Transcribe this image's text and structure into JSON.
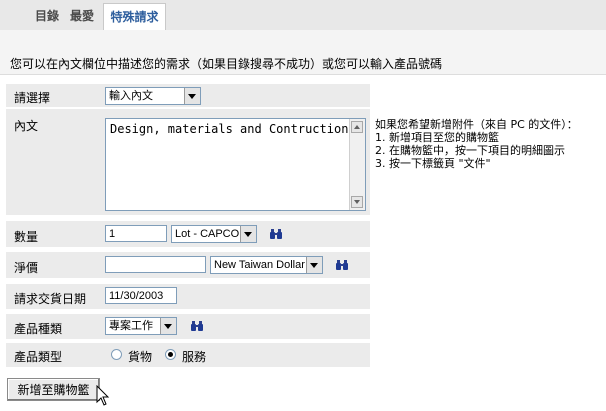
{
  "tabs": [
    {
      "label": "目錄"
    },
    {
      "label": "最愛"
    },
    {
      "label": "特殊請求"
    }
  ],
  "intro": "您可以在內文欄位中描述您的需求（如果目錄搜尋不成功）或您可以輸入產品號碼",
  "form": {
    "select_label": "請選擇",
    "select_value": "輸入內文",
    "content_label": "內文",
    "content_value": "Design, materials and Contruction",
    "quantity_label": "數量",
    "quantity_value": "1",
    "unit_value": "Lot - CAPCO",
    "net_price_label": "淨價",
    "net_price_value": "",
    "currency_value": "New Taiwan Dollar",
    "delivery_date_label": "請求交貨日期",
    "delivery_date_value": "11/30/2003",
    "product_category_label": "產品種類",
    "product_category_value": "專案工作",
    "product_type_label": "產品類型",
    "product_type_options": [
      {
        "label": "貨物",
        "selected": false
      },
      {
        "label": "服務",
        "selected": true
      }
    ],
    "add_to_cart_label": "新增至購物籃"
  },
  "help": {
    "title": "如果您希望新增附件（來自 PC 的文件）：",
    "steps": [
      "新增項目至您的購物籃",
      "在購物籃中，按一下項目的明細圖示",
      "按一下標籤頁 \"文件\""
    ]
  },
  "icons": {
    "search": "binoculars-icon"
  },
  "colors": {
    "active_tab": "#2f5f9e",
    "row_background": "#ebebeb",
    "field_border": "#7f9db9"
  }
}
